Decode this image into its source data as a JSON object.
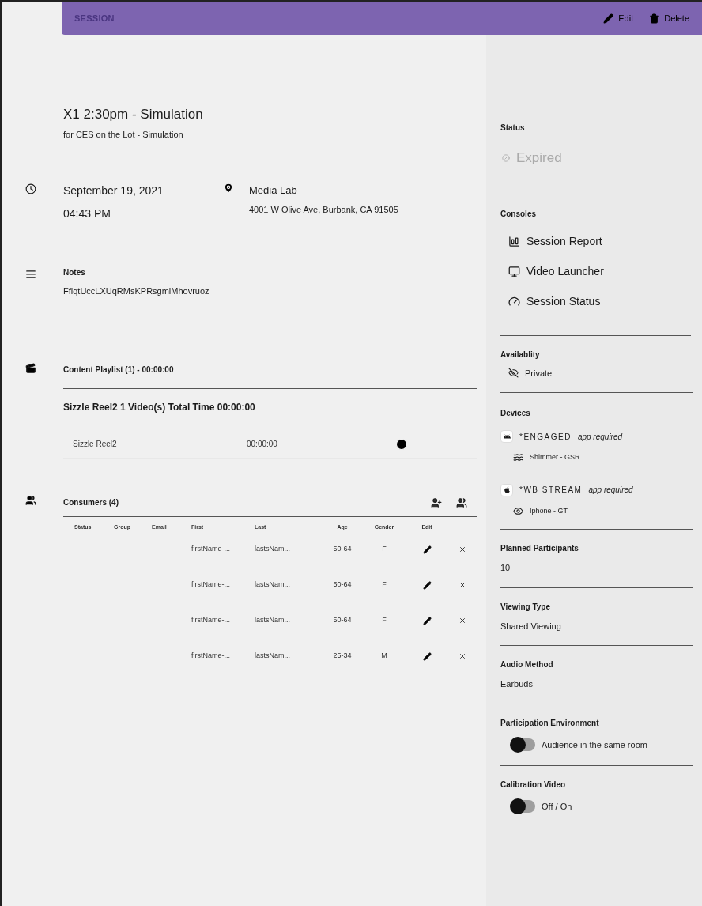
{
  "header": {
    "title": "SESSION",
    "actions": [
      {
        "kind": "edit",
        "label": "Edit"
      },
      {
        "kind": "delete",
        "label": "Delete"
      }
    ]
  },
  "session": {
    "title": "X1 2:30pm - Simulation",
    "subtitle": "for CES on the Lot - Simulation",
    "date": "September 19, 2021",
    "time": "04:43 PM",
    "location": "Media Lab",
    "address": "4001 W Olive Ave, Burbank, CA 91505",
    "notes_label": "Notes",
    "notes": "FflqtUccLXUqRMsKPRsgmiMhovruoz"
  },
  "playlist": {
    "title": "Content Playlist (1) - 00:00:00",
    "summary": "Sizzle Reel2 1 Video(s) Total Time 00:00:00",
    "items": [
      {
        "name": "Sizzle Reel2",
        "duration": "00:00:00"
      }
    ]
  },
  "consumers": {
    "title": "Consumers (4)",
    "columns": [
      "Status",
      "Group",
      "Email",
      "First",
      "Last",
      "Age",
      "Gender",
      "Edit"
    ],
    "rows": [
      {
        "first": "firstName-...",
        "last": "lastsNam...",
        "age": "50-64",
        "gender": "F"
      },
      {
        "first": "firstName-...",
        "last": "lastsNam...",
        "age": "50-64",
        "gender": "F"
      },
      {
        "first": "firstName-...",
        "last": "lastsNam...",
        "age": "50-64",
        "gender": "F"
      },
      {
        "first": "firstName-...",
        "last": "lastsNam...",
        "age": "25-34",
        "gender": "M"
      }
    ]
  },
  "sidebar": {
    "status_label": "Status",
    "status": "Expired",
    "status_disabled": true,
    "consoles_label": "Consoles",
    "consoles": [
      {
        "kind": "report",
        "label": "Session Report"
      },
      {
        "kind": "video",
        "label": "Video Launcher"
      },
      {
        "kind": "status",
        "label": "Session Status"
      }
    ],
    "availability_label": "Availablity",
    "availability": "Private",
    "devices_label": "Devices",
    "devices": [
      {
        "kind": "android",
        "app": "*ENGAGED",
        "note": "app required",
        "device": {
          "kind": "waves",
          "name": "Shimmer - GSR"
        }
      },
      {
        "kind": "apple",
        "app": "*WB STREAM",
        "note": "app required",
        "device": {
          "kind": "eye",
          "name": "Iphone - GT"
        }
      }
    ],
    "fields": [
      {
        "label": "Planned Participants",
        "value": "10"
      },
      {
        "label": "Viewing Type",
        "value": "Shared Viewing"
      },
      {
        "label": "Audio Method",
        "value": "Earbuds"
      }
    ],
    "toggles": [
      {
        "label": "Participation Environment",
        "text": "Audience in the same room",
        "on": false
      },
      {
        "label": "Calibration Video",
        "text": "Off / On",
        "on": false
      }
    ]
  }
}
